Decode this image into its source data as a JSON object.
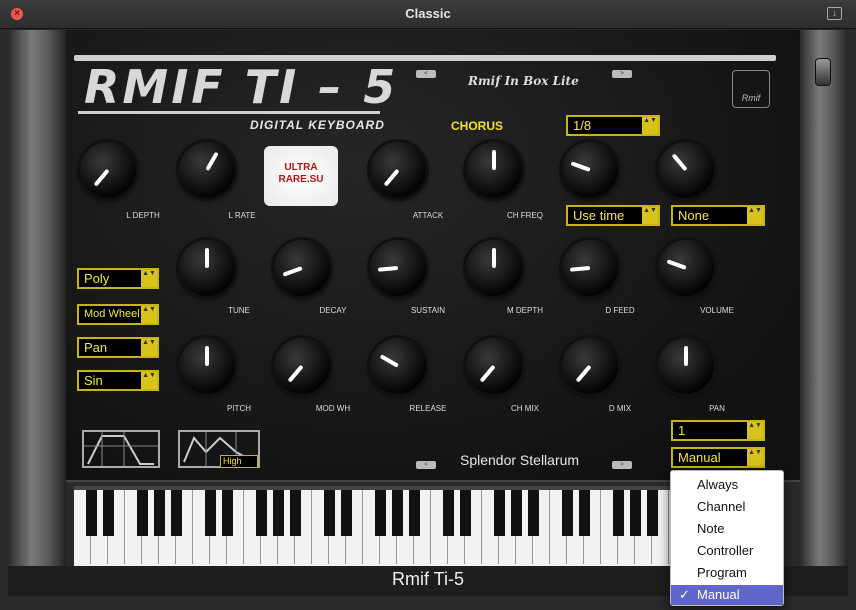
{
  "window": {
    "title": "Classic"
  },
  "plugin": {
    "logo": "RMIF TI – 5",
    "subtitle": "DIGITAL KEYBOARD",
    "brand": "Rmif In Box Lite",
    "brand_icon": "Rmif",
    "footer_title": "Rmif Ti-5"
  },
  "badge": {
    "text": "ULTRA RARE.SU"
  },
  "chorus": {
    "label": "CHORUS"
  },
  "selectors": {
    "division": "1/8",
    "use_time": "Use time",
    "none": "None",
    "poly": "Poly",
    "mod_wheel": "Mod Wheel",
    "pan": "Pan",
    "sin": "Sin",
    "channel": "1",
    "manual": "Manual",
    "envelope_mode": "High"
  },
  "knob_labels": {
    "l_depth": "L DEPTH",
    "l_rate": "L RATE",
    "attack": "ATTACK",
    "ch_freq": "CH FREQ",
    "tune": "TUNE",
    "decay": "DECAY",
    "sustain": "SUSTAIN",
    "m_depth": "M DEPTH",
    "d_feed": "D FEED",
    "volume": "VOLUME",
    "pitch": "PITCH",
    "mod_wh": "MOD WH",
    "release": "RELEASE",
    "ch_mix": "CH MIX",
    "d_mix": "D MIX",
    "pan": "PAN"
  },
  "preset": {
    "name": "Splendor Stellarum"
  },
  "dropdown": {
    "options": [
      "Always",
      "Channel",
      "Note",
      "Controller",
      "Program",
      "Manual"
    ],
    "selected": "Manual",
    "check": "✓"
  },
  "icons": {
    "close": "×",
    "arrow": "▲▼",
    "prev": "<",
    "next": ">"
  }
}
